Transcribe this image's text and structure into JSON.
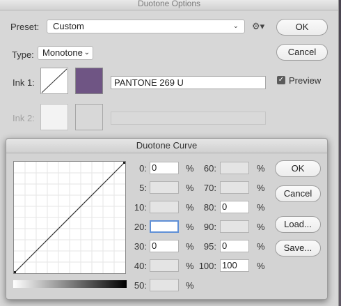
{
  "window": {
    "title": "Duotone Options"
  },
  "preset": {
    "label": "Preset:",
    "value": "Custom"
  },
  "type": {
    "label": "Type:",
    "value": "Monotone"
  },
  "buttons": {
    "ok": "OK",
    "cancel": "Cancel"
  },
  "preview": {
    "label": "Preview",
    "checked": true
  },
  "inks": [
    {
      "label": "Ink 1:",
      "name": "PANTONE 269 U",
      "color": "#6f5584",
      "enabled": true
    },
    {
      "label": "Ink 2:",
      "name": "",
      "color": "#d8d8d8",
      "enabled": false
    }
  ],
  "curve_dialog": {
    "title": "Duotone Curve",
    "buttons": {
      "ok": "OK",
      "cancel": "Cancel",
      "load": "Load...",
      "save": "Save..."
    },
    "left_points": [
      {
        "label": "0:",
        "value": "0"
      },
      {
        "label": "5:",
        "value": ""
      },
      {
        "label": "10:",
        "value": ""
      },
      {
        "label": "20:",
        "value": ""
      },
      {
        "label": "30:",
        "value": "0"
      },
      {
        "label": "40:",
        "value": ""
      },
      {
        "label": "50:",
        "value": ""
      }
    ],
    "right_points": [
      {
        "label": "60:",
        "value": ""
      },
      {
        "label": "70:",
        "value": ""
      },
      {
        "label": "80:",
        "value": "0"
      },
      {
        "label": "90:",
        "value": ""
      },
      {
        "label": "95:",
        "value": "0"
      },
      {
        "label": "100:",
        "value": "100"
      }
    ],
    "percent_sign": "%"
  }
}
